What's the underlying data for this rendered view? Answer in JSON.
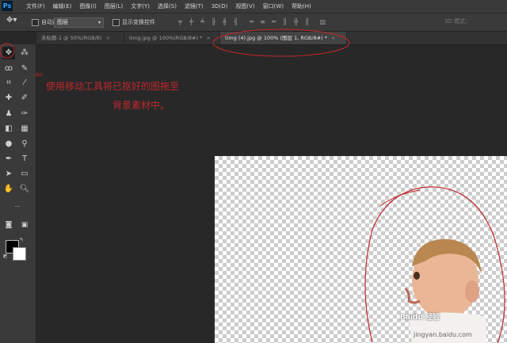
{
  "app": {
    "logo": "Ps"
  },
  "menubar": {
    "items": [
      "文件(F)",
      "编辑(E)",
      "图像(I)",
      "图层(L)",
      "文字(Y)",
      "选择(S)",
      "滤镜(T)",
      "3D(D)",
      "视图(V)",
      "窗口(W)",
      "帮助(H)"
    ]
  },
  "options": {
    "auto_select_label": "自动选择：",
    "auto_select_value": "图层",
    "show_transform_label": "显示变换控件",
    "mode_3d_label": "3D 模式："
  },
  "tabs": [
    {
      "label": "未标题-1 @ 50%(RGB/8)",
      "close": "×"
    },
    {
      "label": "timg.jpg @ 100%(RGB/8#) *",
      "close": "×"
    },
    {
      "label": "timg (4).jpg @ 100% (图层 1, RGB/8#) *",
      "close": "×"
    }
  ],
  "annotation": {
    "line1": "使用移动工具将已抠好的图拖至",
    "line2": "背景素材中。",
    "color": "#c0282d"
  },
  "watermark": {
    "text": "Baidu 经验",
    "url": "jingyan.baidu.com"
  },
  "tools": [
    "move-tool",
    "magic-wand-tool",
    "lasso-tool",
    "brush-quick-tool",
    "crop-tool",
    "eyedropper-tool",
    "healing-brush-tool",
    "brush-tool",
    "clone-stamp-tool",
    "history-brush-tool",
    "eraser-tool",
    "gradient-tool",
    "blur-tool",
    "dodge-tool",
    "pen-tool",
    "type-tool",
    "path-selection-tool",
    "rectangle-tool",
    "hand-tool",
    "zoom-tool"
  ]
}
